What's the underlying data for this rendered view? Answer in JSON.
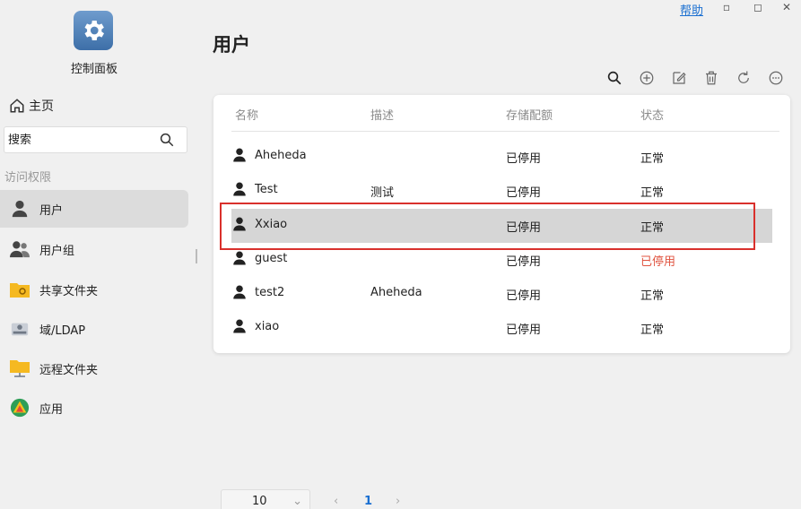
{
  "header": {
    "help_label": "帮助",
    "minimize_glyph": "▫",
    "maximize_glyph": "◻",
    "close_glyph": "✕"
  },
  "app": {
    "name": "控制面板",
    "icon": "gear-icon",
    "accent": "#4f82bb"
  },
  "sidebar": {
    "home_label": "主页",
    "search_placeholder": "搜索",
    "section_label": "访问权限",
    "items": [
      {
        "label": "用户",
        "icon": "user-icon",
        "active": true
      },
      {
        "label": "用户组",
        "icon": "user-group-icon",
        "active": false
      },
      {
        "label": "共享文件夹",
        "icon": "shared-folder-icon",
        "active": false
      },
      {
        "label": "域/LDAP",
        "icon": "ldap-icon",
        "active": false
      },
      {
        "label": "远程文件夹",
        "icon": "remote-folder-icon",
        "active": false
      },
      {
        "label": "应用",
        "icon": "app-icon",
        "active": false
      }
    ]
  },
  "main": {
    "title": "用户",
    "toolbar": [
      "search-icon",
      "add-icon",
      "edit-icon",
      "delete-icon",
      "refresh-icon",
      "more-icon"
    ],
    "table": {
      "columns": [
        "名称",
        "描述",
        "存储配额",
        "状态"
      ],
      "rows": [
        {
          "name": "Aheheda",
          "description": "",
          "quota": "已停用",
          "status": "正常"
        },
        {
          "name": "Test",
          "description": "测试",
          "quota": "已停用",
          "status": "正常"
        },
        {
          "name": "Xxiao",
          "description": "",
          "quota": "已停用",
          "status": "正常",
          "selected": true
        },
        {
          "name": "guest",
          "description": "",
          "quota": "已停用",
          "status": "已停用"
        },
        {
          "name": "test2",
          "description": "Aheheda",
          "quota": "已停用",
          "status": "正常"
        },
        {
          "name": "xiao",
          "description": "",
          "quota": "已停用",
          "status": "正常"
        }
      ]
    },
    "pagination": {
      "page_size": "10",
      "current_page": "1",
      "prev_glyph": "‹",
      "next_glyph": "›",
      "dropdown_glyph": "⌄"
    }
  },
  "colors": {
    "highlight": "#d9302c",
    "status_disabled": "#e0533f",
    "link": "#1a6fd1",
    "selected_row": "#d6d6d6"
  }
}
